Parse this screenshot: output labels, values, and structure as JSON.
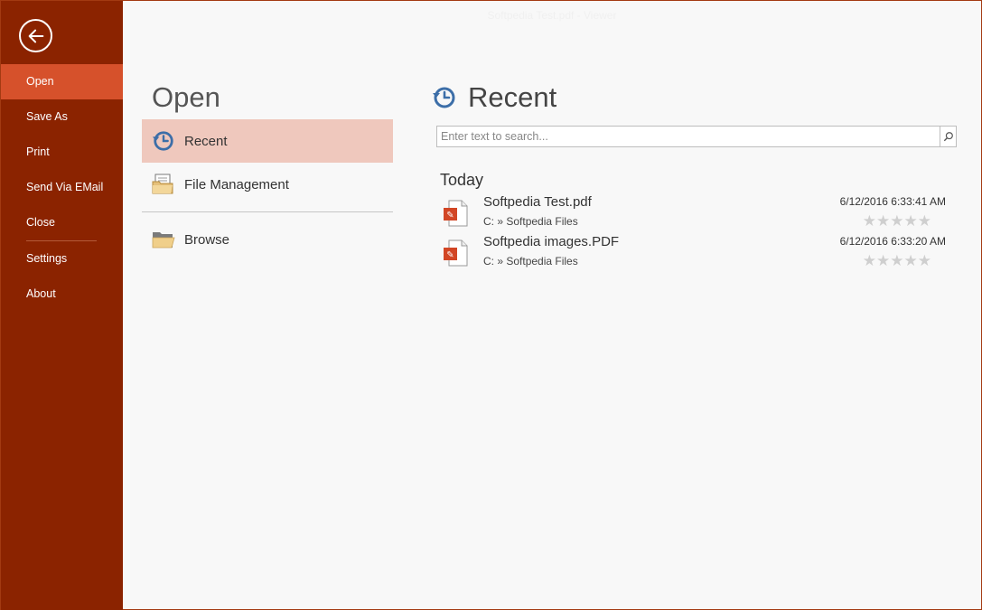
{
  "window": {
    "title": "Softpedia Test.pdf - Viewer",
    "accent": "#8b2300",
    "active_nav": "#d6512b",
    "selected_location": "#efc8bd"
  },
  "sidebar": {
    "back_icon": "arrow-left-circle-icon",
    "items": [
      {
        "label": "Open"
      },
      {
        "label": "Save As"
      },
      {
        "label": "Print"
      },
      {
        "label": "Send Via EMail"
      },
      {
        "label": "Close"
      },
      {
        "label": "Settings"
      },
      {
        "label": "About"
      }
    ]
  },
  "open": {
    "heading": "Open",
    "locations": [
      {
        "label": "Recent",
        "icon": "clock-history-icon"
      },
      {
        "label": "File Management",
        "icon": "folder-documents-icon"
      },
      {
        "label": "Browse",
        "icon": "folder-icon"
      }
    ]
  },
  "recent": {
    "heading": "Recent",
    "search_placeholder": "Enter text to search...",
    "group": "Today",
    "files": [
      {
        "name": "Softpedia Test.pdf",
        "path": "C: » Softpedia Files",
        "date": "6/12/2016 6:33:41 AM",
        "rating": "★★★★★",
        "rating_value": 0
      },
      {
        "name": "Softpedia images.PDF",
        "path": "C: » Softpedia Files",
        "date": "6/12/2016 6:33:20 AM",
        "rating": "★★★★★",
        "rating_value": 0
      }
    ]
  }
}
